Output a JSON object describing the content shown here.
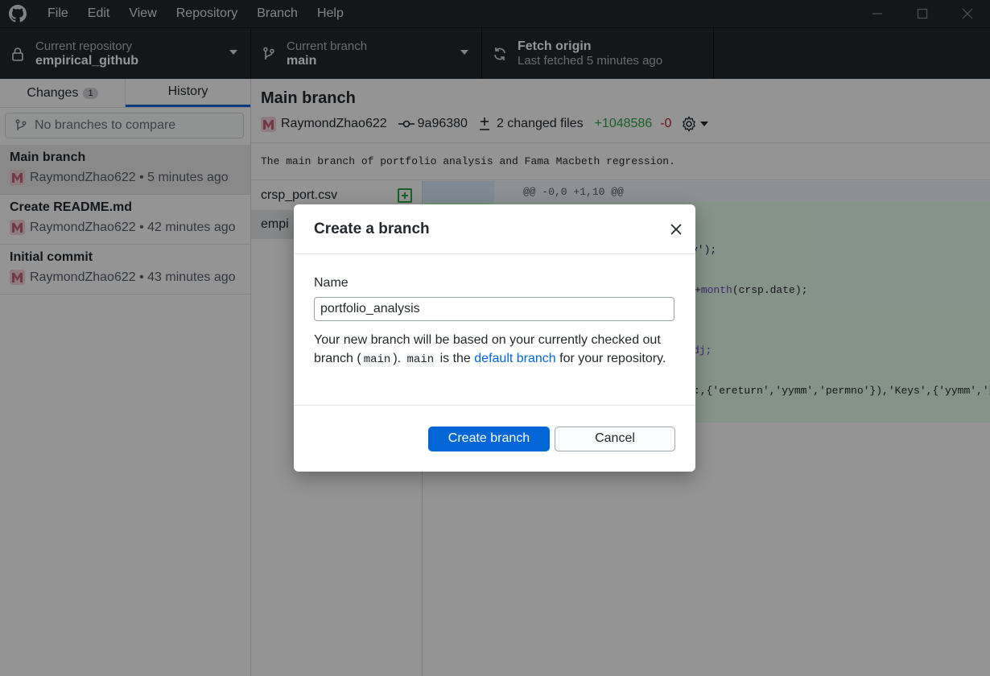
{
  "menu": {
    "file": "File",
    "edit": "Edit",
    "view": "View",
    "repository": "Repository",
    "branch": "Branch",
    "help": "Help"
  },
  "toolbar": {
    "repo_label": "Current repository",
    "repo_value": "empirical_github",
    "branch_label": "Current branch",
    "branch_value": "main",
    "fetch_label": "Fetch origin",
    "fetch_sub": "Last fetched 5 minutes ago"
  },
  "sidebar": {
    "tab_changes": "Changes",
    "changes_count": "1",
    "tab_history": "History",
    "compare_placeholder": "No branches to compare",
    "commits": [
      {
        "title": "Main branch",
        "meta": "RaymondZhao622 • 5 minutes ago"
      },
      {
        "title": "Create README.md",
        "meta": "RaymondZhao622 • 42 minutes ago"
      },
      {
        "title": "Initial commit",
        "meta": "RaymondZhao622 • 43 minutes ago"
      }
    ]
  },
  "commit": {
    "title": "Main branch",
    "author": "RaymondZhao622",
    "sha": "9a96380",
    "changed_files": "2 changed files",
    "added": "+1048586",
    "removed": "-0",
    "description": "The main branch of portfolio analysis and Fama Macbeth regression."
  },
  "files": [
    {
      "name": "crsp_port.csv"
    },
    {
      "name": "empi"
    }
  ],
  "diff": {
    "hunk": "@@ -0,0 +1,10 @@",
    "line_a": "v');",
    "line_b_op": "+",
    "line_b_fn": "month",
    "line_b_rest": "(crsp.date);",
    "line_c": "dj;",
    "line_d": ":,{'ereturn','yymm','permno'}),'Keys',{'yymm','p"
  },
  "dialog": {
    "title": "Create a branch",
    "name_label": "Name",
    "name_value": "portfolio_analysis",
    "help_1": "Your new branch will be based on your currently checked out branch (",
    "help_chip_1": "main",
    "help_2": "). ",
    "help_chip_2": "main",
    "help_3": " is the ",
    "help_link": "default branch",
    "help_4": " for your repository.",
    "create_button": "Create branch",
    "cancel_button": "Cancel"
  },
  "colors": {
    "accent": "#0366d6",
    "toolbar_bg": "#24292e",
    "added": "#28a745",
    "removed": "#cb2431"
  }
}
